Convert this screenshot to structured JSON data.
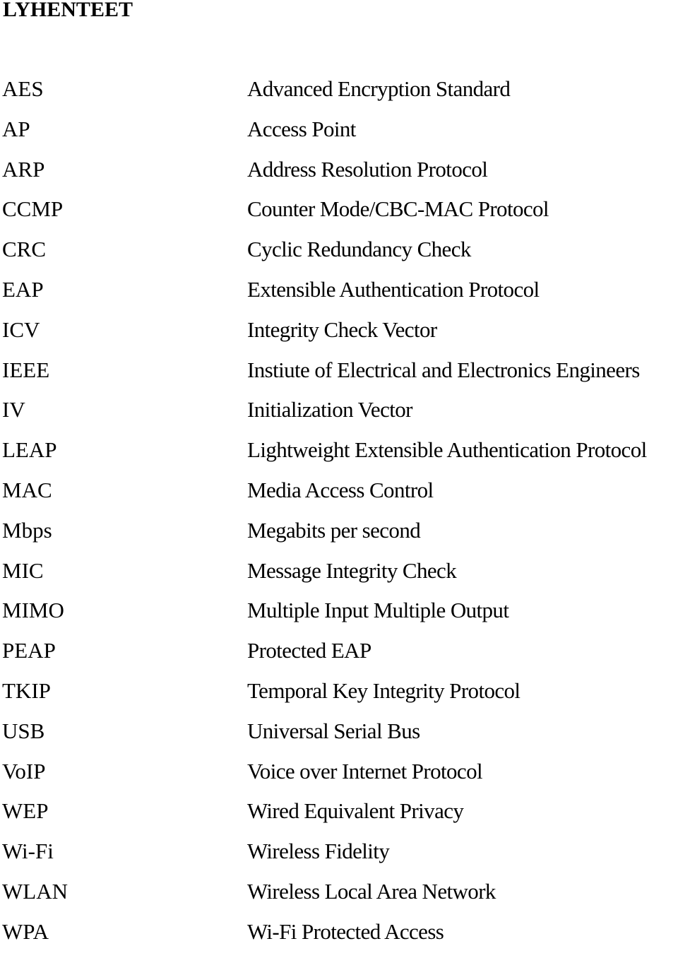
{
  "page": {
    "title": "LYHENTEET",
    "entries": [
      {
        "abbr": "AES",
        "definition": "Advanced Encryption Standard"
      },
      {
        "abbr": "AP",
        "definition": "Access Point"
      },
      {
        "abbr": "ARP",
        "definition": "Address Resolution Protocol"
      },
      {
        "abbr": "CCMP",
        "definition": "Counter Mode/CBC-MAC Protocol"
      },
      {
        "abbr": "CRC",
        "definition": "Cyclic Redundancy Check"
      },
      {
        "abbr": "EAP",
        "definition": "Extensible Authentication Protocol"
      },
      {
        "abbr": "ICV",
        "definition": "Integrity Check Vector"
      },
      {
        "abbr": "IEEE",
        "definition": "Instiute of Electrical and Electronics Engineers"
      },
      {
        "abbr": "IV",
        "definition": "Initialization Vector"
      },
      {
        "abbr": "LEAP",
        "definition": "Lightweight Extensible Authentication Protocol"
      },
      {
        "abbr": "MAC",
        "definition": "Media Access Control"
      },
      {
        "abbr": "Mbps",
        "definition": "Megabits per second"
      },
      {
        "abbr": "MIC",
        "definition": "Message Integrity Check"
      },
      {
        "abbr": "MIMO",
        "definition": "Multiple Input Multiple Output"
      },
      {
        "abbr": "PEAP",
        "definition": "Protected EAP"
      },
      {
        "abbr": "TKIP",
        "definition": "Temporal Key Integrity Protocol"
      },
      {
        "abbr": "USB",
        "definition": "Universal Serial Bus"
      },
      {
        "abbr": "VoIP",
        "definition": "Voice over Internet Protocol"
      },
      {
        "abbr": "WEP",
        "definition": "Wired Equivalent Privacy"
      },
      {
        "abbr": "Wi-Fi",
        "definition": "Wireless Fidelity"
      },
      {
        "abbr": "WLAN",
        "definition": "Wireless Local Area Network"
      },
      {
        "abbr": "WPA",
        "definition": "Wi-Fi Protected Access"
      }
    ]
  }
}
